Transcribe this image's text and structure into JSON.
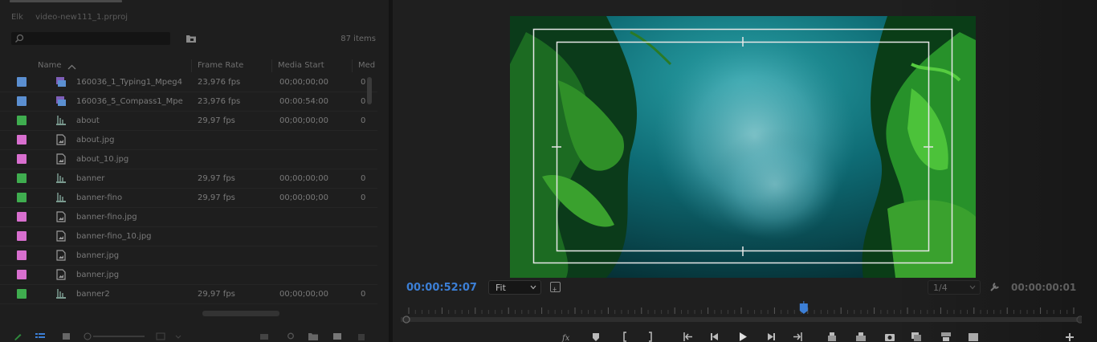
{
  "project_panel": {
    "path_segments": [
      "Elk",
      "video-new111_1.prproj"
    ],
    "search": {
      "placeholder": "",
      "value": ""
    },
    "items_count": "87 items",
    "columns": {
      "name": "Name",
      "frame_rate": "Frame Rate",
      "media_start": "Media Start",
      "med": "Med"
    },
    "rows": [
      {
        "color": "#5b8fd1",
        "type": "video-audio",
        "name": "160036_1_Typing1_Mpeg4",
        "frame_rate": "23,976 fps",
        "media_start": "00;00;00;00",
        "med": "0"
      },
      {
        "color": "#5b8fd1",
        "type": "video-audio",
        "name": "160036_5_Compass1_Mpe",
        "frame_rate": "23,976 fps",
        "media_start": "00:00:54:00",
        "med": "0"
      },
      {
        "color": "#3fad4f",
        "type": "sequence",
        "name": "about",
        "frame_rate": "29,97 fps",
        "media_start": "00;00;00;00",
        "med": "0"
      },
      {
        "color": "#d86fcf",
        "type": "still",
        "name": "about.jpg",
        "frame_rate": "",
        "media_start": "",
        "med": ""
      },
      {
        "color": "#d86fcf",
        "type": "still",
        "name": "about_10.jpg",
        "frame_rate": "",
        "media_start": "",
        "med": ""
      },
      {
        "color": "#3fad4f",
        "type": "sequence",
        "name": "banner",
        "frame_rate": "29,97 fps",
        "media_start": "00;00;00;00",
        "med": "0"
      },
      {
        "color": "#3fad4f",
        "type": "sequence",
        "name": "banner-fino",
        "frame_rate": "29,97 fps",
        "media_start": "00;00;00;00",
        "med": "0"
      },
      {
        "color": "#d86fcf",
        "type": "still",
        "name": "banner-fino.jpg",
        "frame_rate": "",
        "media_start": "",
        "med": ""
      },
      {
        "color": "#d86fcf",
        "type": "still",
        "name": "banner-fino_10.jpg",
        "frame_rate": "",
        "media_start": "",
        "med": ""
      },
      {
        "color": "#d86fcf",
        "type": "still",
        "name": "banner.jpg",
        "frame_rate": "",
        "media_start": "",
        "med": ""
      },
      {
        "color": "#d86fcf",
        "type": "still",
        "name": "banner.jpg",
        "frame_rate": "",
        "media_start": "",
        "med": ""
      },
      {
        "color": "#3fad4f",
        "type": "sequence",
        "name": "banner2",
        "frame_rate": "29,97 fps",
        "media_start": "00;00;00;00",
        "med": "0"
      }
    ]
  },
  "program_monitor": {
    "current_timecode": "00:00:52:07",
    "zoom": "Fit",
    "resolution": "1/4",
    "duration_timecode": "00:00:00:01",
    "playhead_position": 0.594,
    "colors": {
      "accent": "#3c7fd6",
      "safe_margin": "#e6e6e6"
    }
  }
}
